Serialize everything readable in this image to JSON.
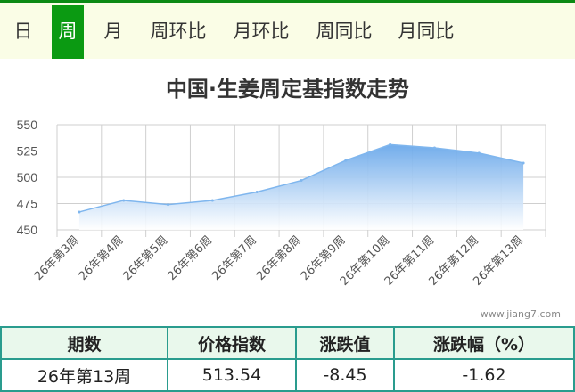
{
  "tabs": [
    {
      "label": "日",
      "active": false
    },
    {
      "label": "周",
      "active": true
    },
    {
      "label": "月",
      "active": false
    },
    {
      "label": "周环比",
      "active": false
    },
    {
      "label": "月环比",
      "active": false
    },
    {
      "label": "周同比",
      "active": false
    },
    {
      "label": "月同比",
      "active": false
    }
  ],
  "chart_data": {
    "type": "area",
    "title": "中国·生姜周定基指数走势",
    "categories": [
      "26年第3周",
      "26年第4周",
      "26年第5周",
      "26年第6周",
      "26年第7周",
      "26年第8周",
      "26年第9周",
      "26年第10周",
      "26年第11周",
      "26年第12周",
      "26年第13周"
    ],
    "values": [
      467,
      478,
      474,
      478,
      486,
      497,
      516,
      531,
      528,
      523,
      513.54
    ],
    "ylim": [
      450,
      550
    ],
    "yticks": [
      450,
      475,
      500,
      525,
      550
    ],
    "grid": true,
    "colors": {
      "line": "#7fb6ee",
      "fill_top": "#6aa8ea",
      "fill_bottom": "#ffffff",
      "grid": "#cfcfcf"
    }
  },
  "watermark": "www.jiang7.com",
  "table": {
    "headers": [
      "期数",
      "价格指数",
      "涨跌值",
      "涨跌幅（%）"
    ],
    "row": [
      "26年第13周",
      "513.54",
      "-8.45",
      "-1.62"
    ]
  },
  "colors": {
    "accent": "#0b9a12",
    "tab_bg": "#fafde6",
    "table_border": "#2a9c8e",
    "table_header_bg": "#e9f8ec"
  }
}
